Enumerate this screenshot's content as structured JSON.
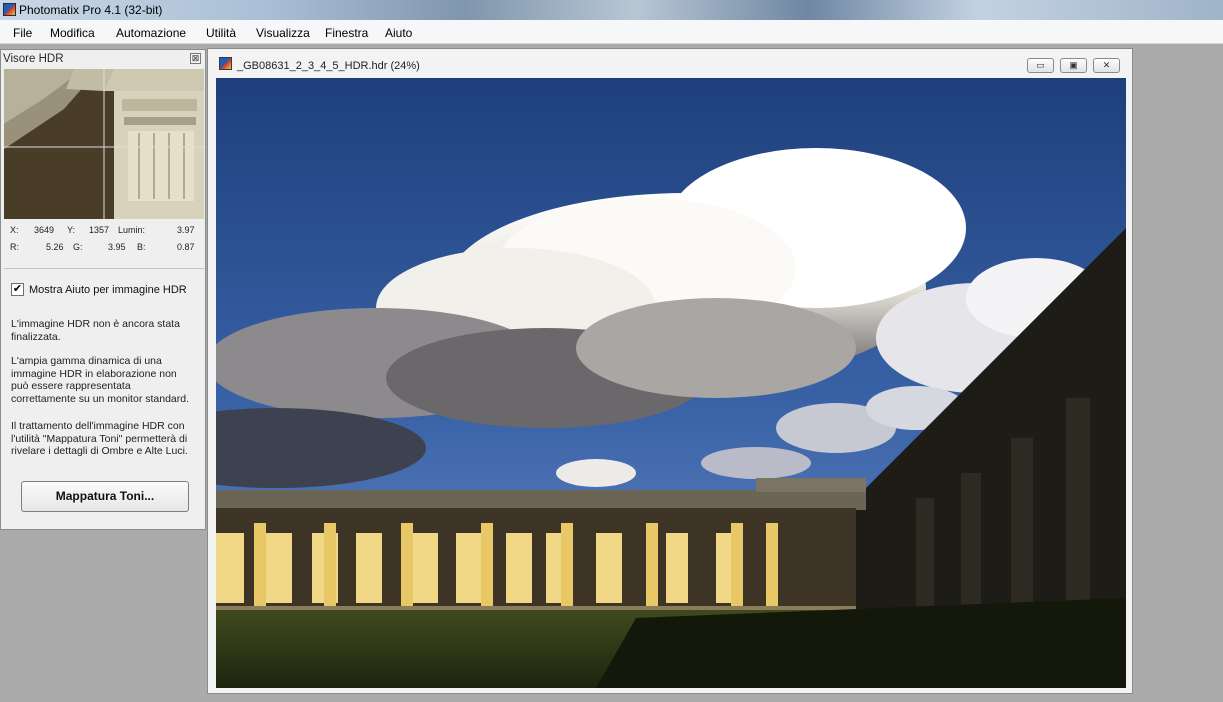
{
  "app": {
    "title": "Photomatix Pro 4.1 (32-bit)"
  },
  "menu": [
    "File",
    "Modifica",
    "Automazione",
    "Utilità",
    "Visualizza",
    "Finestra",
    "Aiuto"
  ],
  "viewer": {
    "title": "Visore HDR",
    "close_glyph": "⊠",
    "readout": {
      "x_label": "X:",
      "x_value": "3649",
      "y_label": "Y:",
      "y_value": "1357",
      "lumin_label": "Lumin:",
      "lumin_value": "3.97",
      "r_label": "R:",
      "r_value": "5.26",
      "g_label": "G:",
      "g_value": "3.95",
      "b_label": "B:",
      "b_value": "0.87"
    },
    "show_help_checked": true,
    "show_help_label": "Mostra Aiuto per immagine HDR",
    "help_lines": [
      [
        "L'immagine HDR non è ancora stata",
        "finalizzata."
      ],
      [
        "L'ampia gamma dinamica di una",
        "immagine HDR in elaborazione non",
        "può essere rappresentata",
        "correttamente su un monitor standard."
      ],
      [
        "Il trattamento dell'immagine HDR con",
        "l'utilità \"Mappatura Toni\" permetterà di",
        "rivelare i dettagli di Ombre e Alte Luci."
      ]
    ],
    "tone_mapping_button": "Mappatura Toni..."
  },
  "document": {
    "title": "_GB08631_2_3_4_5_HDR.hdr (24%)",
    "buttons": {
      "minimize": "▭",
      "maximize": "▣",
      "close": "✕"
    }
  },
  "icons": [
    "app-icon",
    "document-icon",
    "close-icon",
    "checkmark-icon"
  ]
}
